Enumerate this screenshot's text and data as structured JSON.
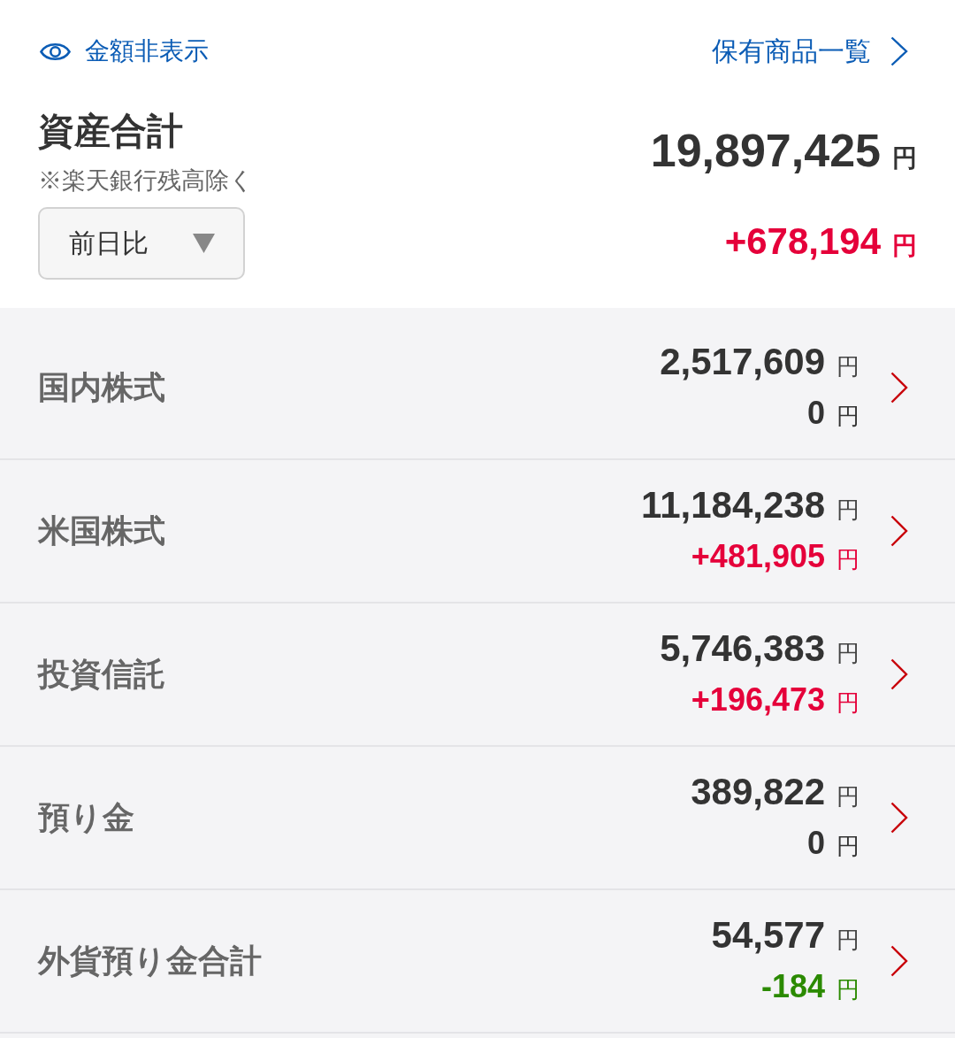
{
  "header": {
    "hide_amounts": {
      "label": "金額非表示"
    },
    "holdings_link": {
      "label": "保有商品一覧"
    }
  },
  "summary": {
    "title": "資産合計",
    "note": "※楽天銀行残高除く",
    "period_select": {
      "value": "前日比"
    },
    "total": {
      "amount": "19,897,425",
      "unit": "円"
    },
    "change": {
      "amount": "+678,194",
      "unit": "円",
      "color": "#e5003a"
    }
  },
  "categories": [
    {
      "name": "国内株式",
      "value": {
        "amount": "2,517,609",
        "unit": "円"
      },
      "change": {
        "amount": "0",
        "unit": "円",
        "color": "#333333"
      }
    },
    {
      "name": "米国株式",
      "value": {
        "amount": "11,184,238",
        "unit": "円"
      },
      "change": {
        "amount": "+481,905",
        "unit": "円",
        "color": "#e5003a"
      }
    },
    {
      "name": "投資信託",
      "value": {
        "amount": "5,746,383",
        "unit": "円"
      },
      "change": {
        "amount": "+196,473",
        "unit": "円",
        "color": "#e5003a"
      }
    },
    {
      "name": "預り金",
      "value": {
        "amount": "389,822",
        "unit": "円"
      },
      "change": {
        "amount": "0",
        "unit": "円",
        "color": "#333333"
      }
    },
    {
      "name": "外貨預り金合計",
      "value": {
        "amount": "54,577",
        "unit": "円"
      },
      "change": {
        "amount": "-184",
        "unit": "円",
        "color": "#2b8a00"
      }
    }
  ]
}
